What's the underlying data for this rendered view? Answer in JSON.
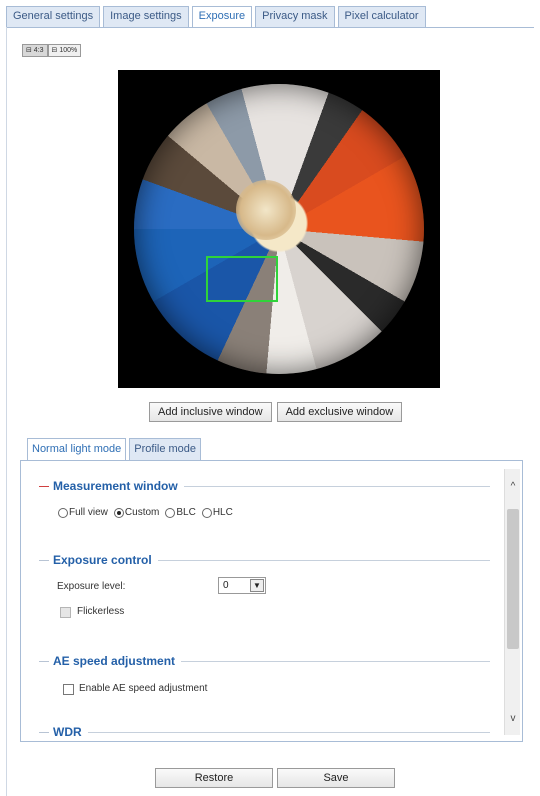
{
  "top_tabs": [
    {
      "label": "General settings"
    },
    {
      "label": "Image settings"
    },
    {
      "label": "Exposure"
    },
    {
      "label": "Privacy mask"
    },
    {
      "label": "Pixel calculator"
    }
  ],
  "active_top_tab": "Exposure",
  "view_mode_buttons": [
    "⊟ 4:3",
    "⊟ 100%"
  ],
  "window_buttons": {
    "add_inclusive": "Add inclusive window",
    "add_exclusive": "Add exclusive window"
  },
  "mode_tabs": [
    {
      "label": "Normal light mode"
    },
    {
      "label": "Profile mode"
    }
  ],
  "measurement": {
    "title": "Measurement window",
    "options": [
      "Full view",
      "Custom",
      "BLC",
      "HLC"
    ],
    "selected": "Custom"
  },
  "exposure_control": {
    "title": "Exposure control",
    "level_label": "Exposure level:",
    "level_value": "0",
    "flickerless_label": "Flickerless"
  },
  "ae_speed": {
    "title": "AE speed adjustment",
    "enable_label": "Enable AE speed adjustment"
  },
  "wdr": {
    "title": "WDR"
  },
  "scroll": {
    "up_icon": "^",
    "down_icon": "v"
  },
  "footer": {
    "restore": "Restore",
    "save": "Save"
  },
  "colors": {
    "accent": "#2460a8",
    "measurement_window": "#2fd33a",
    "section_dash": "#d04040"
  }
}
